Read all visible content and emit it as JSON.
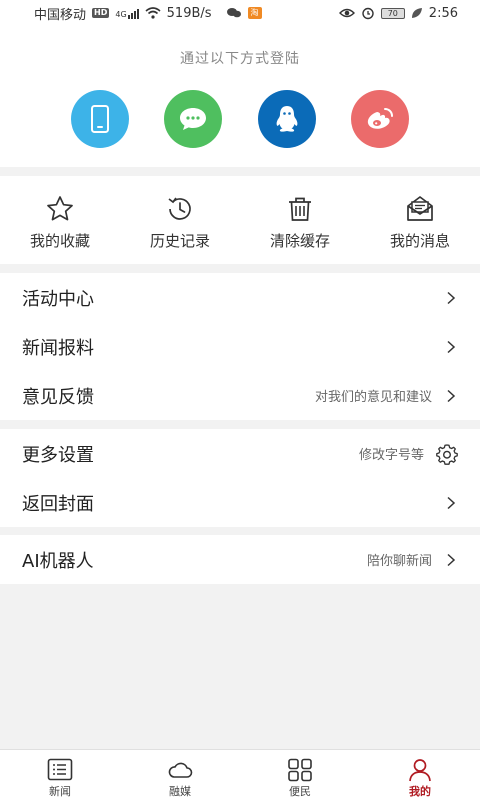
{
  "status_bar": {
    "carrier": "中国移动",
    "hd_tag": "HD",
    "net_tag": "4G",
    "speed": "519B/s",
    "battery": "70",
    "time": "2:56"
  },
  "login": {
    "title": "通过以下方式登陆",
    "methods": [
      {
        "name": "phone",
        "icon": "phone-icon",
        "color": "#3db3e8"
      },
      {
        "name": "wechat",
        "icon": "wechat-icon",
        "color": "#4fbf5f"
      },
      {
        "name": "qq",
        "icon": "qq-icon",
        "color": "#0b6bb8"
      },
      {
        "name": "weibo",
        "icon": "weibo-icon",
        "color": "#eb6b6b"
      }
    ]
  },
  "quick_actions": [
    {
      "label": "我的收藏",
      "icon": "star-icon"
    },
    {
      "label": "历史记录",
      "icon": "history-icon"
    },
    {
      "label": "清除缓存",
      "icon": "trash-icon"
    },
    {
      "label": "我的消息",
      "icon": "mail-icon"
    }
  ],
  "menu": {
    "activity_center": "活动中心",
    "news_report": "新闻报料",
    "feedback": "意见反馈",
    "feedback_hint": "对我们的意见和建议",
    "more_settings": "更多设置",
    "more_settings_hint": "修改字号等",
    "back_to_cover": "返回封面",
    "ai_robot": "AI机器人",
    "ai_robot_hint": "陪你聊新闻"
  },
  "bottom_nav": [
    {
      "label": "新闻",
      "icon": "news-list-icon",
      "active": false
    },
    {
      "label": "融媒",
      "icon": "cloud-icon",
      "active": false
    },
    {
      "label": "便民",
      "icon": "grid-icon",
      "active": false
    },
    {
      "label": "我的",
      "icon": "user-icon",
      "active": true
    }
  ],
  "colors": {
    "accent": "#b01b22",
    "background": "#f2f2f2"
  }
}
